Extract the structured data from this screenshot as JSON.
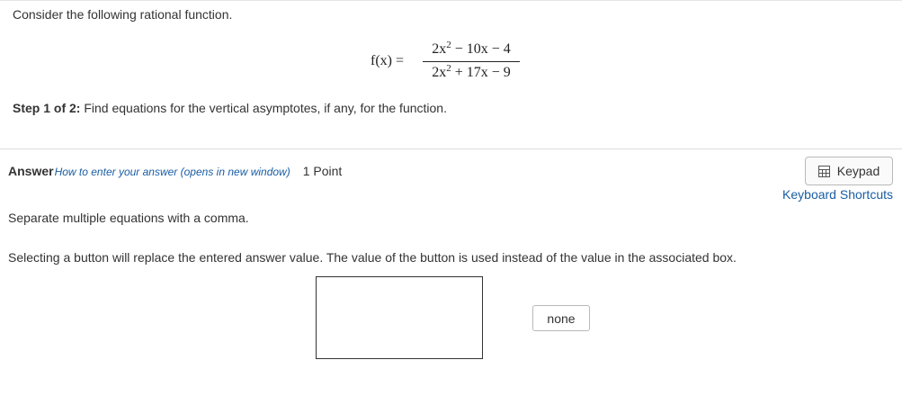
{
  "question": {
    "intro": "Consider the following rational function.",
    "formula": {
      "lhs": "f(x) =",
      "numerator": {
        "lead": "2x",
        "exp": "2",
        "rest": " − 10x − 4"
      },
      "denominator": {
        "lead": "2x",
        "exp": "2",
        "rest": " + 17x − 9"
      }
    },
    "step": {
      "label": "Step 1 of 2:",
      "text": " Find equations for the vertical asymptotes, if any, for the function."
    }
  },
  "answer": {
    "label": "Answer",
    "help_link": "How to enter your answer (opens in new window)",
    "points": "1 Point",
    "keypad_label": "Keypad",
    "keyboard_shortcuts": "Keyboard Shortcuts",
    "instruction_separate": "Separate multiple equations with a comma.",
    "instruction_buttons": "Selecting a button will replace the entered answer value. The value of the button is used instead of the value in the associated box.",
    "input_value": "",
    "none_button": "none"
  },
  "icons": {
    "keypad": "keypad-icon"
  }
}
